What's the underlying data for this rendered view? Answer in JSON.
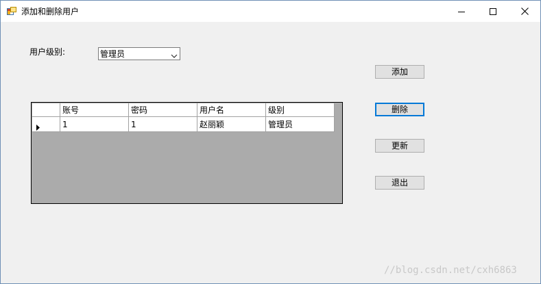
{
  "window": {
    "title": "添加和删除用户",
    "icon": "form-window-icon",
    "controls": [
      "minimize-icon",
      "maximize-icon",
      "close-icon"
    ]
  },
  "form": {
    "level_label": "用户级别:",
    "level_combo": {
      "selected": "管理员"
    }
  },
  "buttons": {
    "add": "添加",
    "delete": "删除",
    "refresh": "更新",
    "exit": "退出"
  },
  "grid": {
    "columns": [
      "账号",
      "密码",
      "用户名",
      "级别"
    ],
    "rows": [
      [
        "1",
        "1",
        "赵丽颖",
        "管理员"
      ]
    ],
    "current_row_marker": "row-pointer-icon"
  },
  "watermark": "//blog.csdn.net/cxh6863",
  "colors": {
    "client_bg": "#f0f0f0",
    "grid_bg": "#ababab",
    "default_button_border": "#0078d7"
  }
}
